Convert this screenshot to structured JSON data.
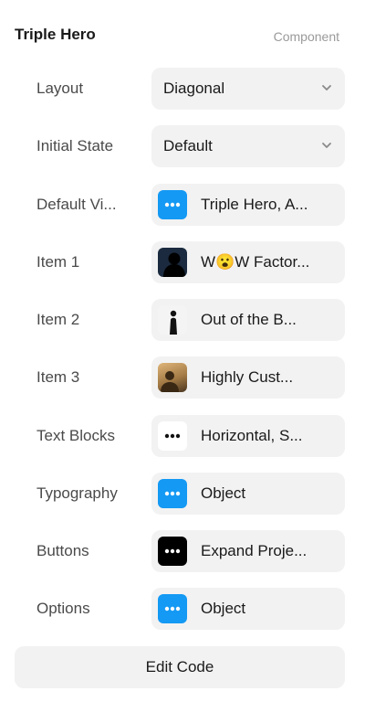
{
  "panel": {
    "title": "Triple Hero",
    "kind": "Component"
  },
  "rows": [
    {
      "label": "Layout",
      "value": "Diagonal",
      "control": "select"
    },
    {
      "label": "Initial State",
      "value": "Default",
      "control": "select"
    },
    {
      "label": "Default Vi...",
      "value": "Triple Hero, A...",
      "control": "object",
      "icon": "ellipsis-icon"
    },
    {
      "label": "Item 1",
      "value": "W😮W Factor...",
      "control": "image",
      "icon": "image-thumbnail"
    },
    {
      "label": "Item 2",
      "value": "Out of the B...",
      "control": "image",
      "icon": "image-thumbnail"
    },
    {
      "label": "Item 3",
      "value": "Highly Cust...",
      "control": "image",
      "icon": "image-thumbnail"
    },
    {
      "label": "Text Blocks",
      "value": "Horizontal, S...",
      "control": "object",
      "icon": "ellipsis-icon"
    },
    {
      "label": "Typography",
      "value": "Object",
      "control": "object",
      "icon": "ellipsis-icon"
    },
    {
      "label": "Buttons",
      "value": "Expand Proje...",
      "control": "object",
      "icon": "ellipsis-icon"
    },
    {
      "label": "Options",
      "value": "Object",
      "control": "object",
      "icon": "ellipsis-icon"
    }
  ],
  "footer": {
    "edit_code_label": "Edit Code"
  },
  "colors": {
    "accent": "#1499f4",
    "control_bg": "#f2f2f2",
    "label": "#4a4a4a",
    "muted": "#9a9a9a"
  }
}
